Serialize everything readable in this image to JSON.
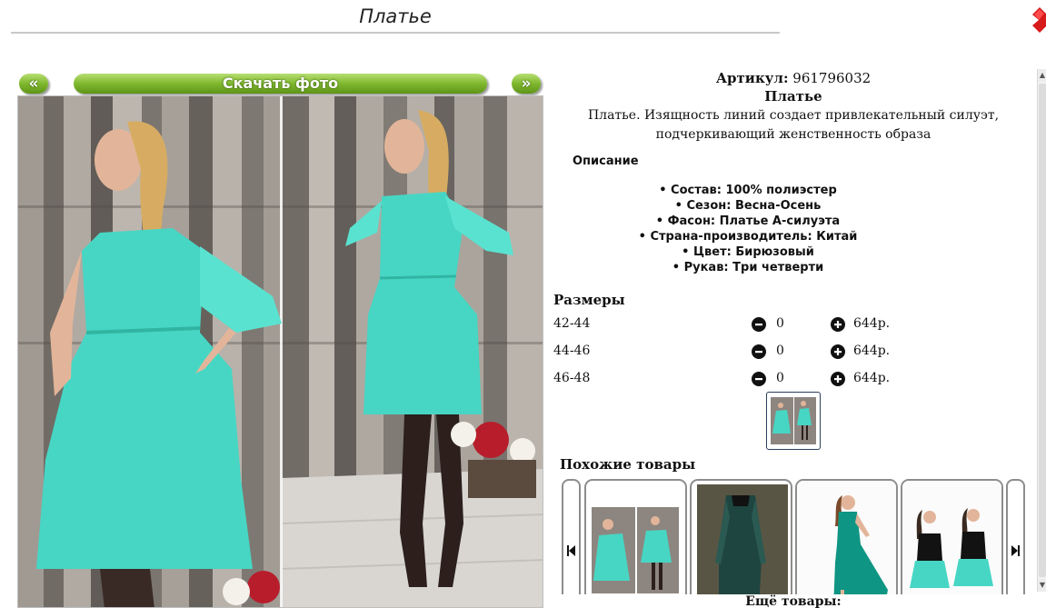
{
  "header": {
    "title": "Платье",
    "close_icon": "close-x-icon"
  },
  "gallery": {
    "prev_label": "«",
    "download_label": "Скачать фото",
    "next_label": "»"
  },
  "product": {
    "article_label": "Артикул:",
    "article_value": "961796032",
    "name": "Платье",
    "description": "Платье. Изящность линий создает привлекательный силуэт, подчеркивающий женственность образа",
    "description_heading": "Описание",
    "features": [
      "Состав: 100% полиэстер",
      "Сезон: Весна-Осень",
      "Фасон: Платье А-силуэта",
      "Страна-производитель: Китай",
      "Цвет: Бирюзовый",
      "Рукав: Три четверти"
    ]
  },
  "sizes": {
    "heading": "Размеры",
    "rows": [
      {
        "size": "42-44",
        "qty": "0",
        "price": "644р."
      },
      {
        "size": "44-46",
        "qty": "0",
        "price": "644р."
      },
      {
        "size": "46-48",
        "qty": "0",
        "price": "644р."
      }
    ]
  },
  "similar": {
    "heading": "Похожие товары",
    "more_label": "Ещё товары:"
  },
  "colors": {
    "accent_green": "#7fb82f",
    "dress": "#47d6c4",
    "thumb_border": "#2c3f5c"
  }
}
